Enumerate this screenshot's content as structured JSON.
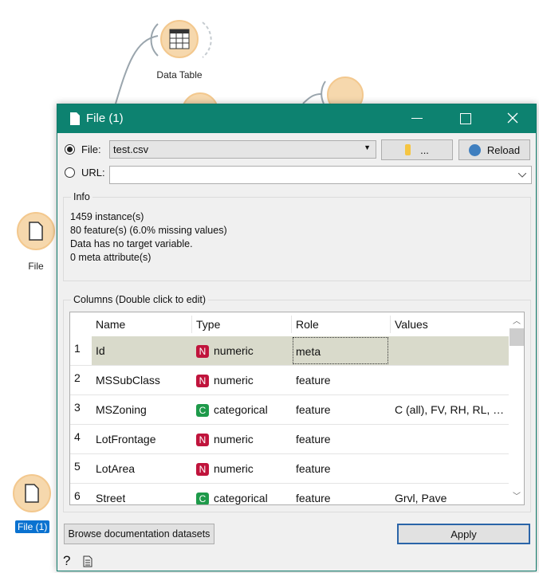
{
  "canvas": {
    "nodes": [
      {
        "label": "Data Table",
        "icon": "table-icon"
      },
      {
        "label": "File",
        "icon": "file-icon"
      },
      {
        "label": "File (1)",
        "icon": "file-icon",
        "selected": true
      }
    ]
  },
  "window": {
    "title": "File (1)"
  },
  "source": {
    "file_label": "File:",
    "file_value": "test.csv",
    "browse_label": "...",
    "reload_label": "Reload",
    "url_label": "URL:",
    "url_value": "",
    "selected": "file"
  },
  "info": {
    "title": "Info",
    "lines": [
      "1459 instance(s)",
      "80 feature(s) (6.0% missing values)",
      "Data has no target variable.",
      "0 meta attribute(s)"
    ]
  },
  "columns": {
    "title": "Columns (Double click to edit)",
    "headers": [
      "Name",
      "Type",
      "Role",
      "Values"
    ],
    "rows": [
      {
        "n": "1",
        "name": "Id",
        "type": "numeric",
        "badge": "N",
        "role": "meta",
        "values": ""
      },
      {
        "n": "2",
        "name": "MSSubClass",
        "type": "numeric",
        "badge": "N",
        "role": "feature",
        "values": ""
      },
      {
        "n": "3",
        "name": "MSZoning",
        "type": "categorical",
        "badge": "C",
        "role": "feature",
        "values": "C (all), FV, RH, RL, R..."
      },
      {
        "n": "4",
        "name": "LotFrontage",
        "type": "numeric",
        "badge": "N",
        "role": "feature",
        "values": ""
      },
      {
        "n": "5",
        "name": "LotArea",
        "type": "numeric",
        "badge": "N",
        "role": "feature",
        "values": ""
      },
      {
        "n": "6",
        "name": "Street",
        "type": "categorical",
        "badge": "C",
        "role": "feature",
        "values": "Grvl, Pave"
      }
    ]
  },
  "buttons": {
    "browse_docs": "Browse documentation datasets",
    "apply": "Apply"
  },
  "colors": {
    "titlebar": "#0d8270",
    "numeric": "#c0143c",
    "categorical": "#1e9a4a",
    "selected_row": "#d9dacb",
    "node": "#f6d8ad"
  }
}
